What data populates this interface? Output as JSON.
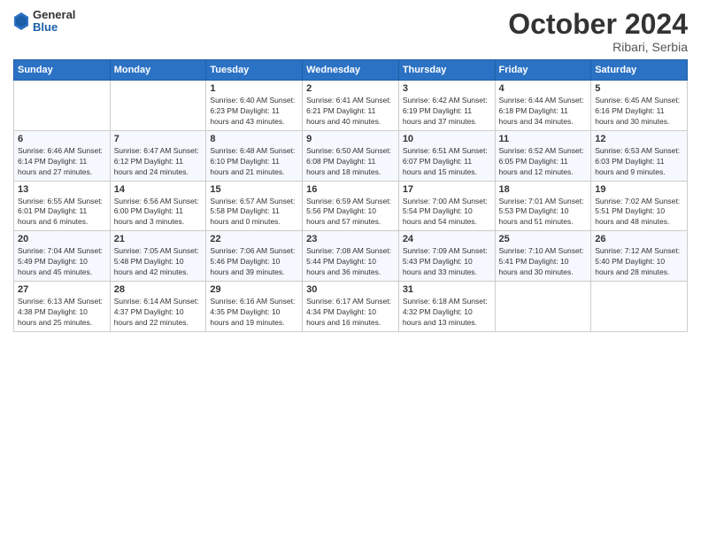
{
  "header": {
    "logo": {
      "line1": "General",
      "line2": "Blue"
    },
    "title": "October 2024",
    "location": "Ribari, Serbia"
  },
  "days_of_week": [
    "Sunday",
    "Monday",
    "Tuesday",
    "Wednesday",
    "Thursday",
    "Friday",
    "Saturday"
  ],
  "weeks": [
    [
      {
        "day": "",
        "info": ""
      },
      {
        "day": "",
        "info": ""
      },
      {
        "day": "1",
        "info": "Sunrise: 6:40 AM\nSunset: 6:23 PM\nDaylight: 11 hours and 43 minutes."
      },
      {
        "day": "2",
        "info": "Sunrise: 6:41 AM\nSunset: 6:21 PM\nDaylight: 11 hours and 40 minutes."
      },
      {
        "day": "3",
        "info": "Sunrise: 6:42 AM\nSunset: 6:19 PM\nDaylight: 11 hours and 37 minutes."
      },
      {
        "day": "4",
        "info": "Sunrise: 6:44 AM\nSunset: 6:18 PM\nDaylight: 11 hours and 34 minutes."
      },
      {
        "day": "5",
        "info": "Sunrise: 6:45 AM\nSunset: 6:16 PM\nDaylight: 11 hours and 30 minutes."
      }
    ],
    [
      {
        "day": "6",
        "info": "Sunrise: 6:46 AM\nSunset: 6:14 PM\nDaylight: 11 hours and 27 minutes."
      },
      {
        "day": "7",
        "info": "Sunrise: 6:47 AM\nSunset: 6:12 PM\nDaylight: 11 hours and 24 minutes."
      },
      {
        "day": "8",
        "info": "Sunrise: 6:48 AM\nSunset: 6:10 PM\nDaylight: 11 hours and 21 minutes."
      },
      {
        "day": "9",
        "info": "Sunrise: 6:50 AM\nSunset: 6:08 PM\nDaylight: 11 hours and 18 minutes."
      },
      {
        "day": "10",
        "info": "Sunrise: 6:51 AM\nSunset: 6:07 PM\nDaylight: 11 hours and 15 minutes."
      },
      {
        "day": "11",
        "info": "Sunrise: 6:52 AM\nSunset: 6:05 PM\nDaylight: 11 hours and 12 minutes."
      },
      {
        "day": "12",
        "info": "Sunrise: 6:53 AM\nSunset: 6:03 PM\nDaylight: 11 hours and 9 minutes."
      }
    ],
    [
      {
        "day": "13",
        "info": "Sunrise: 6:55 AM\nSunset: 6:01 PM\nDaylight: 11 hours and 6 minutes."
      },
      {
        "day": "14",
        "info": "Sunrise: 6:56 AM\nSunset: 6:00 PM\nDaylight: 11 hours and 3 minutes."
      },
      {
        "day": "15",
        "info": "Sunrise: 6:57 AM\nSunset: 5:58 PM\nDaylight: 11 hours and 0 minutes."
      },
      {
        "day": "16",
        "info": "Sunrise: 6:59 AM\nSunset: 5:56 PM\nDaylight: 10 hours and 57 minutes."
      },
      {
        "day": "17",
        "info": "Sunrise: 7:00 AM\nSunset: 5:54 PM\nDaylight: 10 hours and 54 minutes."
      },
      {
        "day": "18",
        "info": "Sunrise: 7:01 AM\nSunset: 5:53 PM\nDaylight: 10 hours and 51 minutes."
      },
      {
        "day": "19",
        "info": "Sunrise: 7:02 AM\nSunset: 5:51 PM\nDaylight: 10 hours and 48 minutes."
      }
    ],
    [
      {
        "day": "20",
        "info": "Sunrise: 7:04 AM\nSunset: 5:49 PM\nDaylight: 10 hours and 45 minutes."
      },
      {
        "day": "21",
        "info": "Sunrise: 7:05 AM\nSunset: 5:48 PM\nDaylight: 10 hours and 42 minutes."
      },
      {
        "day": "22",
        "info": "Sunrise: 7:06 AM\nSunset: 5:46 PM\nDaylight: 10 hours and 39 minutes."
      },
      {
        "day": "23",
        "info": "Sunrise: 7:08 AM\nSunset: 5:44 PM\nDaylight: 10 hours and 36 minutes."
      },
      {
        "day": "24",
        "info": "Sunrise: 7:09 AM\nSunset: 5:43 PM\nDaylight: 10 hours and 33 minutes."
      },
      {
        "day": "25",
        "info": "Sunrise: 7:10 AM\nSunset: 5:41 PM\nDaylight: 10 hours and 30 minutes."
      },
      {
        "day": "26",
        "info": "Sunrise: 7:12 AM\nSunset: 5:40 PM\nDaylight: 10 hours and 28 minutes."
      }
    ],
    [
      {
        "day": "27",
        "info": "Sunrise: 6:13 AM\nSunset: 4:38 PM\nDaylight: 10 hours and 25 minutes."
      },
      {
        "day": "28",
        "info": "Sunrise: 6:14 AM\nSunset: 4:37 PM\nDaylight: 10 hours and 22 minutes."
      },
      {
        "day": "29",
        "info": "Sunrise: 6:16 AM\nSunset: 4:35 PM\nDaylight: 10 hours and 19 minutes."
      },
      {
        "day": "30",
        "info": "Sunrise: 6:17 AM\nSunset: 4:34 PM\nDaylight: 10 hours and 16 minutes."
      },
      {
        "day": "31",
        "info": "Sunrise: 6:18 AM\nSunset: 4:32 PM\nDaylight: 10 hours and 13 minutes."
      },
      {
        "day": "",
        "info": ""
      },
      {
        "day": "",
        "info": ""
      }
    ]
  ]
}
